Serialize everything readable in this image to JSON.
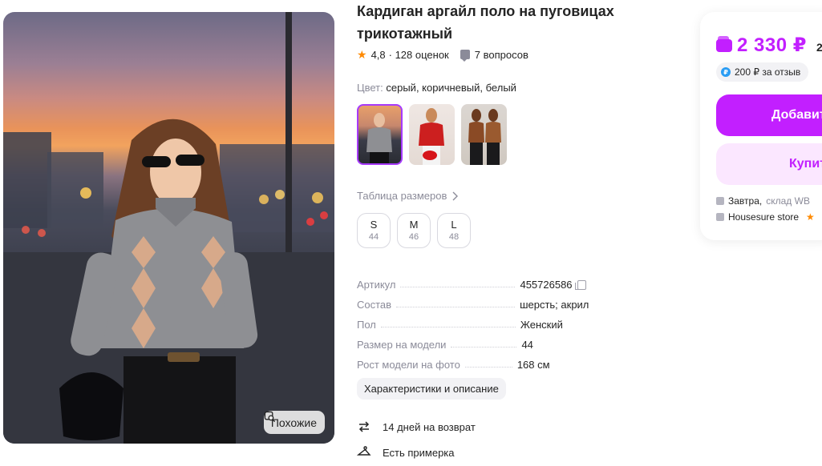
{
  "product": {
    "title": "Кардиган аргайл поло на пуговицах трикотажный",
    "rating": "4,8",
    "reviews": "· 128 оценок",
    "questions": "7 вопросов",
    "color_label": "Цвет:",
    "color_value": "серый, коричневый, белый"
  },
  "gallery": {
    "similar_label": "Похожие"
  },
  "sizes": {
    "table_link": "Таблица размеров",
    "options": [
      {
        "label": "S",
        "num": "44"
      },
      {
        "label": "M",
        "num": "46"
      },
      {
        "label": "L",
        "num": "48"
      }
    ]
  },
  "specs": [
    {
      "key": "Артикул",
      "value": "455726586"
    },
    {
      "key": "Состав",
      "value": "шерсть; акрил"
    },
    {
      "key": "Пол",
      "value": "Женский"
    },
    {
      "key": "Размер на модели",
      "value": "44"
    },
    {
      "key": "Рост модели на фото",
      "value": "168 см"
    }
  ],
  "chars_button": "Характеристики и описание",
  "features": {
    "return": "14 дней на возврат",
    "fitting": "Есть примерка"
  },
  "buy": {
    "price": "2 330 ₽",
    "price_cut": "2",
    "review_bonus": "200 ₽  за отзыв",
    "add_label": "Добавит",
    "buy_label": "Купит",
    "delivery_day": "Завтра,",
    "delivery_place": "склад WB",
    "store": "Housesure store",
    "accent": "#c21fff"
  }
}
